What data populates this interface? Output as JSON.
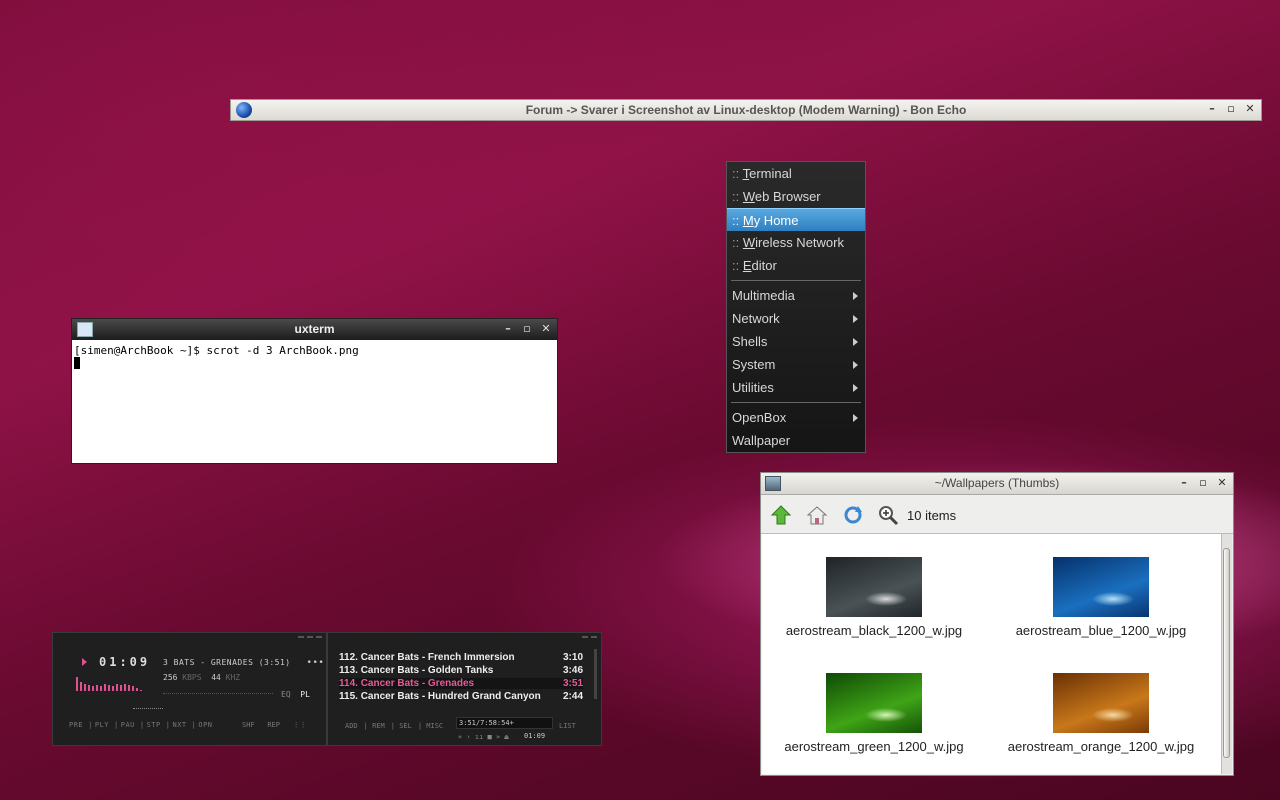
{
  "browser": {
    "title": "Forum -> Svarer i Screenshot av Linux-desktop (Modem Warning) - Bon Echo",
    "buttons": {
      "minimize": "–",
      "maximize": "▫",
      "close": "✕"
    }
  },
  "menu": {
    "items": [
      {
        "prefix": ":: ",
        "accel": "T",
        "rest": "erminal"
      },
      {
        "prefix": ":: ",
        "accel": "W",
        "rest": "eb Browser"
      },
      {
        "prefix": ":: ",
        "accel": "M",
        "rest": "y Home"
      },
      {
        "prefix": ":: ",
        "accel": "W",
        "rest": "ireless Network"
      },
      {
        "prefix": ":: ",
        "accel": "E",
        "rest": "ditor"
      }
    ],
    "submenus": [
      "Multimedia",
      "Network",
      "Shells",
      "System",
      "Utilities"
    ],
    "openbox": "OpenBox",
    "wallpaper": "Wallpaper"
  },
  "uxterm": {
    "title": "uxterm",
    "line1": "[simen@ArchBook ~]$ scrot -d 3 ArchBook.png",
    "buttons": {
      "minimize": "–",
      "maximize": "▫",
      "close": "✕"
    }
  },
  "thunar": {
    "title": "~/Wallpapers (Thumbs)",
    "items_count": "10 items",
    "toolbar_icons": [
      "up-arrow-icon",
      "home-icon",
      "refresh-icon",
      "zoom-icon"
    ],
    "files": [
      {
        "name": "aerostream_black_1200_w.jpg",
        "c1": "#1e2326",
        "c2": "#5b6368"
      },
      {
        "name": "aerostream_blue_1200_w.jpg",
        "c1": "#05316a",
        "c2": "#2e8fe0"
      },
      {
        "name": "aerostream_green_1200_w.jpg",
        "c1": "#0f4a06",
        "c2": "#56c61e"
      },
      {
        "name": "aerostream_orange_1200_w.jpg",
        "c1": "#6a3004",
        "c2": "#e0901c"
      }
    ],
    "buttons": {
      "minimize": "–",
      "maximize": "▫",
      "close": "✕"
    }
  },
  "player": {
    "time": "01:09",
    "marquee": "3 BATS - GRENADES (3:51)",
    "more": "•••",
    "kbps": "256",
    "kbps_unit": "KBPS",
    "khz": "44",
    "khz_unit": "KHZ",
    "eq": "EQ",
    "pl": "PL",
    "controls": [
      "PRE",
      "PLY",
      "PAU",
      "STP",
      "NXT",
      "OPN"
    ],
    "shf": "SHF",
    "rep": "REP",
    "accent": "#e0508f",
    "playlist": [
      {
        "title": "112. Cancer Bats - French Immersion",
        "dur": "3:10"
      },
      {
        "title": "113. Cancer Bats - Golden Tanks",
        "dur": "3:46"
      },
      {
        "title": "114. Cancer Bats - Grenades",
        "dur": "3:51",
        "current": true
      },
      {
        "title": "115. Cancer Bats - Hundred Grand Canyon",
        "dur": "2:44"
      }
    ],
    "pl_buttons": [
      "ADD",
      "REM",
      "SEL",
      "MISC"
    ],
    "pl_info": "3:51/7:58:54+",
    "pl_mini": "«  ›  ıı  ■  »  ⏏",
    "pl_time": "01:09",
    "pl_list": "LIST"
  }
}
